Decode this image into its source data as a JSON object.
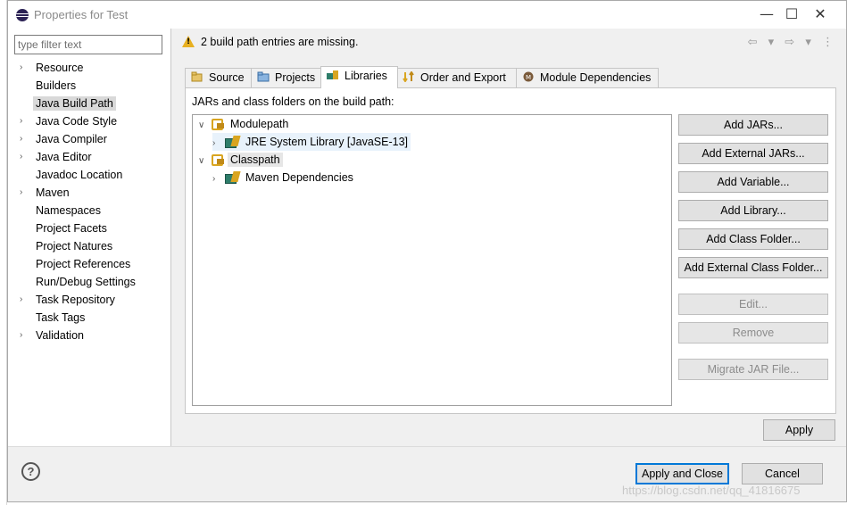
{
  "window": {
    "title": "Properties for Test",
    "minimize": "—",
    "maximize": "☐",
    "close": "✕"
  },
  "sidebar": {
    "filter_placeholder": "type filter text",
    "items": [
      {
        "label": "Resource",
        "expandable": true
      },
      {
        "label": "Builders",
        "expandable": false
      },
      {
        "label": "Java Build Path",
        "expandable": false,
        "selected": true
      },
      {
        "label": "Java Code Style",
        "expandable": true
      },
      {
        "label": "Java Compiler",
        "expandable": true
      },
      {
        "label": "Java Editor",
        "expandable": true
      },
      {
        "label": "Javadoc Location",
        "expandable": false
      },
      {
        "label": "Maven",
        "expandable": true
      },
      {
        "label": "Namespaces",
        "expandable": false
      },
      {
        "label": "Project Facets",
        "expandable": false
      },
      {
        "label": "Project Natures",
        "expandable": false
      },
      {
        "label": "Project References",
        "expandable": false
      },
      {
        "label": "Run/Debug Settings",
        "expandable": false
      },
      {
        "label": "Task Repository",
        "expandable": true
      },
      {
        "label": "Task Tags",
        "expandable": false
      },
      {
        "label": "Validation",
        "expandable": true
      }
    ]
  },
  "message": {
    "text": "2 build path entries are missing.",
    "nav": "⇦ ▾ ⇨ ▾ ⋮"
  },
  "tabs": [
    {
      "label": "Source"
    },
    {
      "label": "Projects"
    },
    {
      "label": "Libraries",
      "active": true
    },
    {
      "label": "Order and Export"
    },
    {
      "label": "Module Dependencies"
    }
  ],
  "panel": {
    "label": "JARs and class folders on the build path:",
    "tree": {
      "modulepath": "Modulepath",
      "jre": "JRE System Library [JavaSE-13]",
      "classpath": "Classpath",
      "maven": "Maven Dependencies"
    },
    "buttons": {
      "add_jars": "Add JARs...",
      "add_external_jars": "Add External JARs...",
      "add_variable": "Add Variable...",
      "add_library": "Add Library...",
      "add_class_folder": "Add Class Folder...",
      "add_external_class_folder": "Add External Class Folder...",
      "edit": "Edit...",
      "remove": "Remove",
      "migrate_jar": "Migrate JAR File..."
    },
    "apply": "Apply"
  },
  "footer": {
    "help": "?",
    "apply_close": "Apply and Close",
    "cancel": "Cancel",
    "watermark": "https://blog.csdn.net/qq_41816675"
  }
}
